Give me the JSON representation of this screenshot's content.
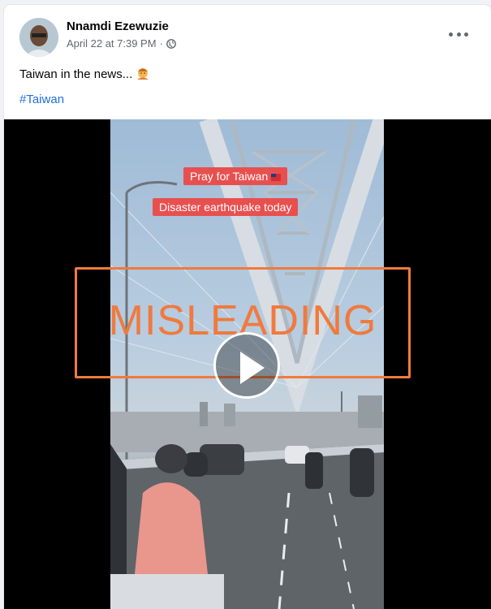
{
  "post": {
    "author": "Nnamdi Ezewuzie",
    "date": "April 22 at 7:39 PM",
    "separator": "·",
    "text": "Taiwan in the news...",
    "hashtag": "#Taiwan"
  },
  "video": {
    "overlay_1": "Pray for Taiwan",
    "overlay_2": "Disaster earthquake today",
    "stamp": "MISLEADING"
  },
  "icons": {
    "more": "more-options-icon",
    "audience": "globe-icon",
    "emoji": "shrugging-emoji",
    "play": "play-icon"
  },
  "colors": {
    "hashtag": "#216fdb",
    "stamp": "#f07a3d",
    "overlay": "#e8504f"
  }
}
